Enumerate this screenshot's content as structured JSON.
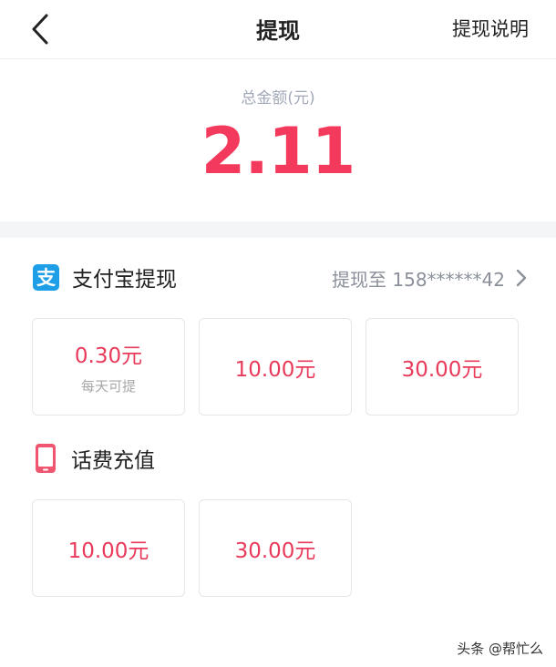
{
  "header": {
    "title": "提现",
    "help_link": "提现说明"
  },
  "balance": {
    "label": "总金额(元)",
    "amount": "2.11"
  },
  "alipay": {
    "icon_glyph": "支",
    "title": "支付宝提现",
    "destination": "提现至 158******42",
    "options": [
      {
        "amount": "0.30元",
        "note": "每天可提"
      },
      {
        "amount": "10.00元"
      },
      {
        "amount": "30.00元"
      }
    ]
  },
  "phone_topup": {
    "title": "话费充值",
    "options": [
      {
        "amount": "10.00元"
      },
      {
        "amount": "30.00元"
      }
    ]
  },
  "watermark": "头条 @帮忙么",
  "colors": {
    "accent": "#f43a5c",
    "alipay_blue": "#1f9ee8",
    "muted": "#a2a8b8"
  },
  "icons": {
    "back": "chevron-left-icon",
    "alipay": "alipay-icon",
    "destination": "chevron-right-icon",
    "phone": "phone-icon"
  }
}
